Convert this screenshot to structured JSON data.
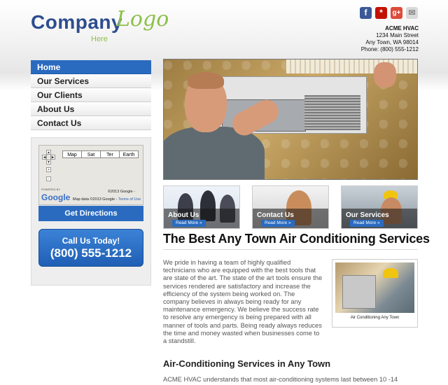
{
  "logo": {
    "company": "Company",
    "script": "Logo",
    "here": "Here"
  },
  "social": {
    "facebook": "f",
    "yelp": "*",
    "gplus": "g+",
    "email": "✉"
  },
  "address": {
    "name": "ACME HVAC",
    "street": "1234 Main Street",
    "city": "Any Town, WA 98014",
    "phone": "Phone: (800) 555-1212"
  },
  "nav": {
    "items": [
      {
        "label": "Home"
      },
      {
        "label": "Our Services"
      },
      {
        "label": "Our Clients"
      },
      {
        "label": "About Us"
      },
      {
        "label": "Contact Us"
      }
    ]
  },
  "map": {
    "types": [
      "Map",
      "Sat",
      "Ter",
      "Earth"
    ],
    "powered": "POWERED BY",
    "google": "Google",
    "copyright": "©2013 Google -",
    "map_data": "Map data ©2013 Google -",
    "terms": "Terms of Use"
  },
  "sidebar": {
    "directions": "Get Directions",
    "call_label": "Call Us Today!",
    "call_number": "(800) 555-1212"
  },
  "thumbs": [
    {
      "title": "About Us",
      "read_more": "Read More »"
    },
    {
      "title": "Contact Us",
      "read_more": "Read More »"
    },
    {
      "title": "Our Services",
      "read_more": "Read More »"
    }
  ],
  "content": {
    "heading": "The Best Any Town Air Conditioning Services",
    "paragraph": "We pride in having a team of highly qualified technicians who are equipped with the best tools that are state of the art. The state of the art tools ensure the services rendered are satisfactory and increase the efficiency of the system being worked on. The company believes in always being ready for any maintenance emergency. We believe the success rate to resolve any emergency is being prepared with all manner of tools and parts. Being ready always reduces the time and money wasted when businesses come to a standstill.",
    "photo_caption": "Air Conditioning Any Town",
    "subheading": "Air-Conditioning Services in Any Town",
    "paragraph2": "ACME HVAC understands that most air-conditioning systems last between 10 -14"
  }
}
